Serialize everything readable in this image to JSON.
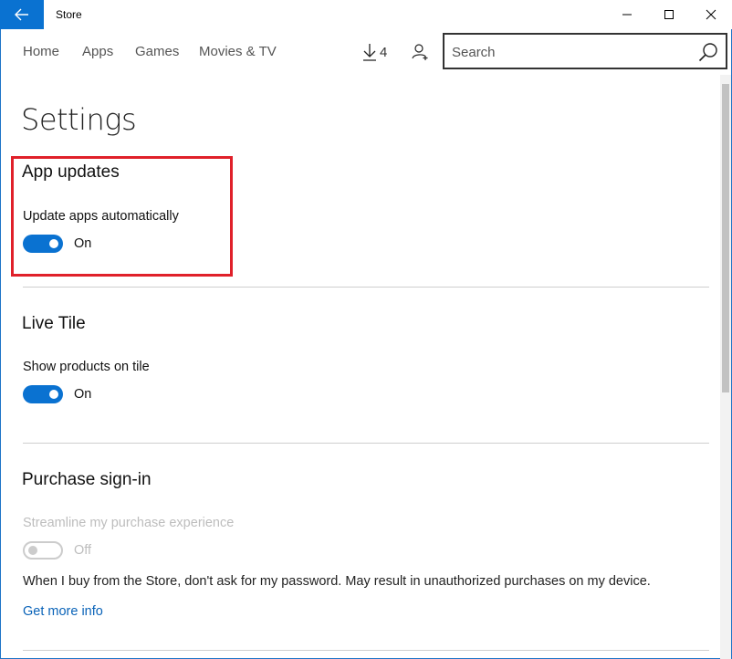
{
  "window": {
    "title": "Store",
    "accent_color": "#0a72d1"
  },
  "nav": {
    "links": [
      "Home",
      "Apps",
      "Games",
      "Movies & TV"
    ],
    "downloads_count": "4",
    "search_placeholder": "Search"
  },
  "page": {
    "title": "Settings"
  },
  "sections": {
    "app_updates": {
      "heading": "App updates",
      "label": "Update apps automatically",
      "state": "On",
      "enabled": true
    },
    "live_tile": {
      "heading": "Live Tile",
      "label": "Show products on tile",
      "state": "On",
      "enabled": true
    },
    "purchase_signin": {
      "heading": "Purchase sign-in",
      "label": "Streamline my purchase experience",
      "state": "Off",
      "enabled": false,
      "description": "When I buy from the Store, don't ask for my password. May result in unauthorized purchases on my device.",
      "link": "Get more info"
    }
  },
  "highlight_color": "#e0202a"
}
